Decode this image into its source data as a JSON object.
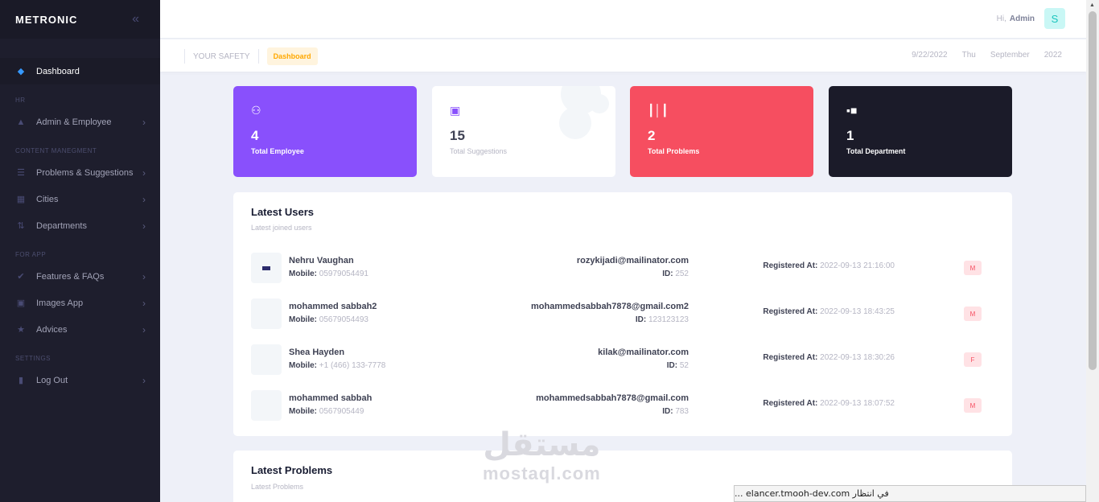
{
  "brand": {
    "name": "METRONIC"
  },
  "sidebar": {
    "dashboard": "Dashboard",
    "sections": {
      "hr": "HR",
      "content": "CONTENT MANEGMENT",
      "app": "FOR APP",
      "settings": "SETTINGS"
    },
    "items": {
      "admin": "Admin & Employee",
      "problems": "Problems & Suggestions",
      "cities": "Cities",
      "departments": "Departments",
      "features": "Features & FAQs",
      "images": "Images App",
      "advices": "Advices",
      "logout": "Log Out"
    }
  },
  "header": {
    "greeting": "Hi,",
    "user": "Admin",
    "avatar_letter": "S"
  },
  "subheader": {
    "title": "YOUR SAFETY",
    "badge": "Dashboard",
    "date": "9/22/2022",
    "day": "Thu",
    "month": "September",
    "year": "2022"
  },
  "stats": [
    {
      "value": "4",
      "label": "Total Employee",
      "color": "#8950fc"
    },
    {
      "value": "15",
      "label": "Total Suggestions",
      "color": "#ffffff"
    },
    {
      "value": "2",
      "label": "Total Problems",
      "color": "#f64e60"
    },
    {
      "value": "1",
      "label": "Total Department",
      "color": "#1b1b29"
    }
  ],
  "latest_users": {
    "title": "Latest Users",
    "subtitle": "Latest joined users",
    "mobile_label": "Mobile:",
    "id_label": "ID:",
    "registered_label": "Registered At:",
    "rows": [
      {
        "name": "Nehru Vaughan",
        "mobile": "05979054491",
        "email": "rozykijadi@mailinator.com",
        "id": "252",
        "registered": "2022-09-13 21:16:00",
        "gender": "M"
      },
      {
        "name": "mohammed sabbah2",
        "mobile": "05679054493",
        "email": "mohammedsabbah7878@gmail.com2",
        "id": "123123123",
        "registered": "2022-09-13 18:43:25",
        "gender": "M"
      },
      {
        "name": "Shea Hayden",
        "mobile": "+1 (466) 133-7778",
        "email": "kilak@mailinator.com",
        "id": "52",
        "registered": "2022-09-13 18:30:26",
        "gender": "F"
      },
      {
        "name": "mohammed sabbah",
        "mobile": "0567905449",
        "email": "mohammedsabbah7878@gmail.com",
        "id": "783",
        "registered": "2022-09-13 18:07:52",
        "gender": "M"
      }
    ]
  },
  "latest_problems": {
    "title": "Latest Problems",
    "subtitle": "Latest Problems"
  },
  "watermark": {
    "arabic": "مستقل",
    "latin": "mostaql.com"
  },
  "statusbar": {
    "text": "في انتظار elancer.tmooh-dev.com ..."
  }
}
